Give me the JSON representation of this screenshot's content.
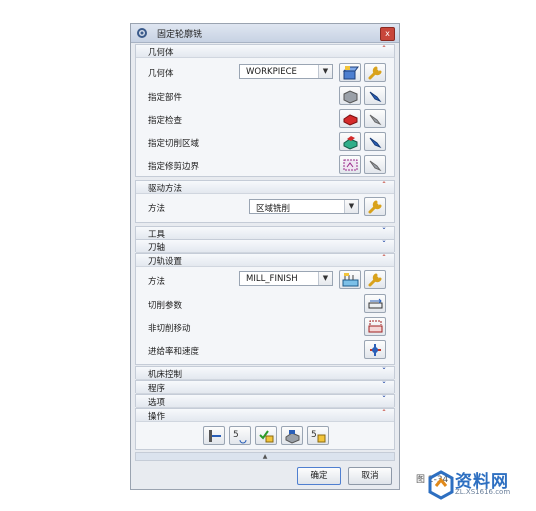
{
  "dialog": {
    "title": "固定轮廓铣",
    "close_label": "x"
  },
  "geometry": {
    "section_label": "几何体",
    "geometry_label": "几何体",
    "geometry_value": "WORKPIECE",
    "specify_part": "指定部件",
    "specify_check": "指定检查",
    "specify_cut_area": "指定切削区域",
    "specify_trim_boundary": "指定修剪边界"
  },
  "drive": {
    "section_label": "驱动方法",
    "method_label": "方法",
    "method_value": "区域铣削"
  },
  "tool": {
    "section_label": "工具"
  },
  "axis": {
    "section_label": "刀轴"
  },
  "path": {
    "section_label": "刀轨设置",
    "method_label": "方法",
    "method_value": "MILL_FINISH",
    "cut_params": "切削参数",
    "non_cut_moves": "非切削移动",
    "feeds_speeds": "进给率和速度"
  },
  "collapsed": {
    "machine_control": "机床控制",
    "program": "程序",
    "options": "选项"
  },
  "actions": {
    "section_label": "操作"
  },
  "footer": {
    "ok_label": "确定",
    "cancel_label": "取消"
  },
  "watermark": {
    "side_text": "图 2-34",
    "site_name": "资料网",
    "site_url": "ZL.XS1616.com"
  },
  "colors": {
    "expanded_chevron": "#c0392b",
    "collapsed_chevron": "#2a4fa8",
    "close_button": "#c8463a"
  }
}
